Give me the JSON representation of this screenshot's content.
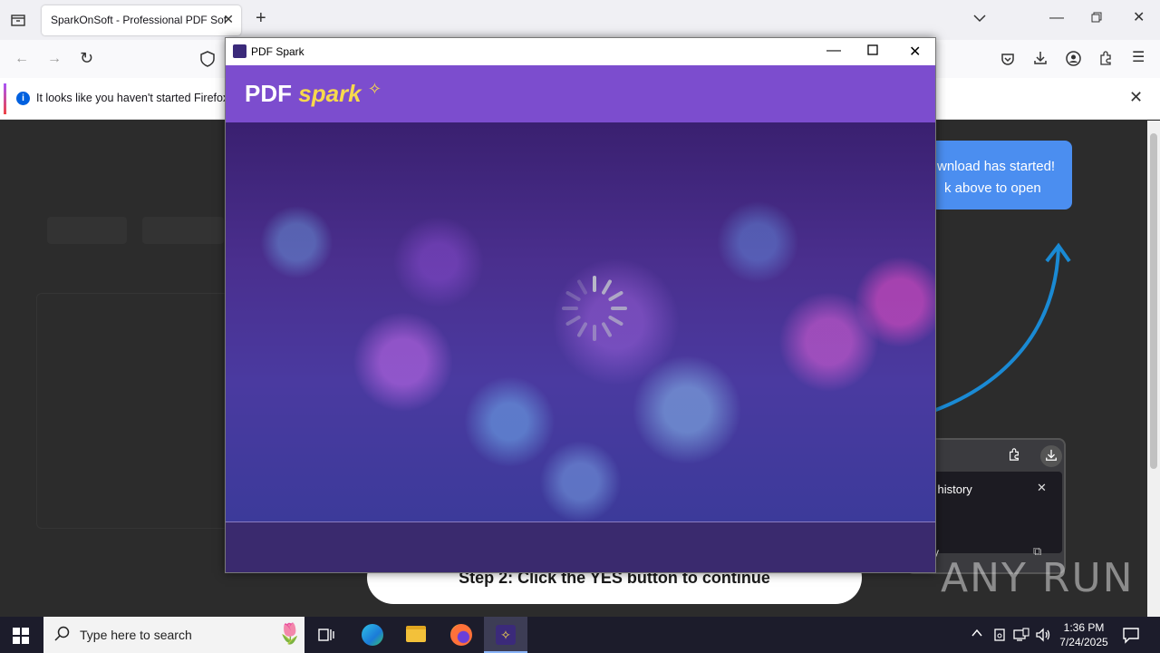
{
  "browser": {
    "tab_title": "SparkOnSoft - Professional PDF Sof",
    "new_tab": "+",
    "notification_text": "It looks like you haven't started Firefox"
  },
  "page": {
    "download_bubble": {
      "line1": "wnload has started!",
      "line2": "k above to open"
    },
    "download_panel": {
      "title_fragment": "l history",
      "line_fragment": "y"
    },
    "step2": "Step 2: Click the YES button to continue",
    "watermark": "ANY RUN"
  },
  "app": {
    "window_title": "PDF Spark",
    "logo_text": "PDF",
    "logo_spark": "spark"
  },
  "taskbar": {
    "search_placeholder": "Type here to search",
    "time": "1:36 PM",
    "date": "7/24/2025"
  }
}
